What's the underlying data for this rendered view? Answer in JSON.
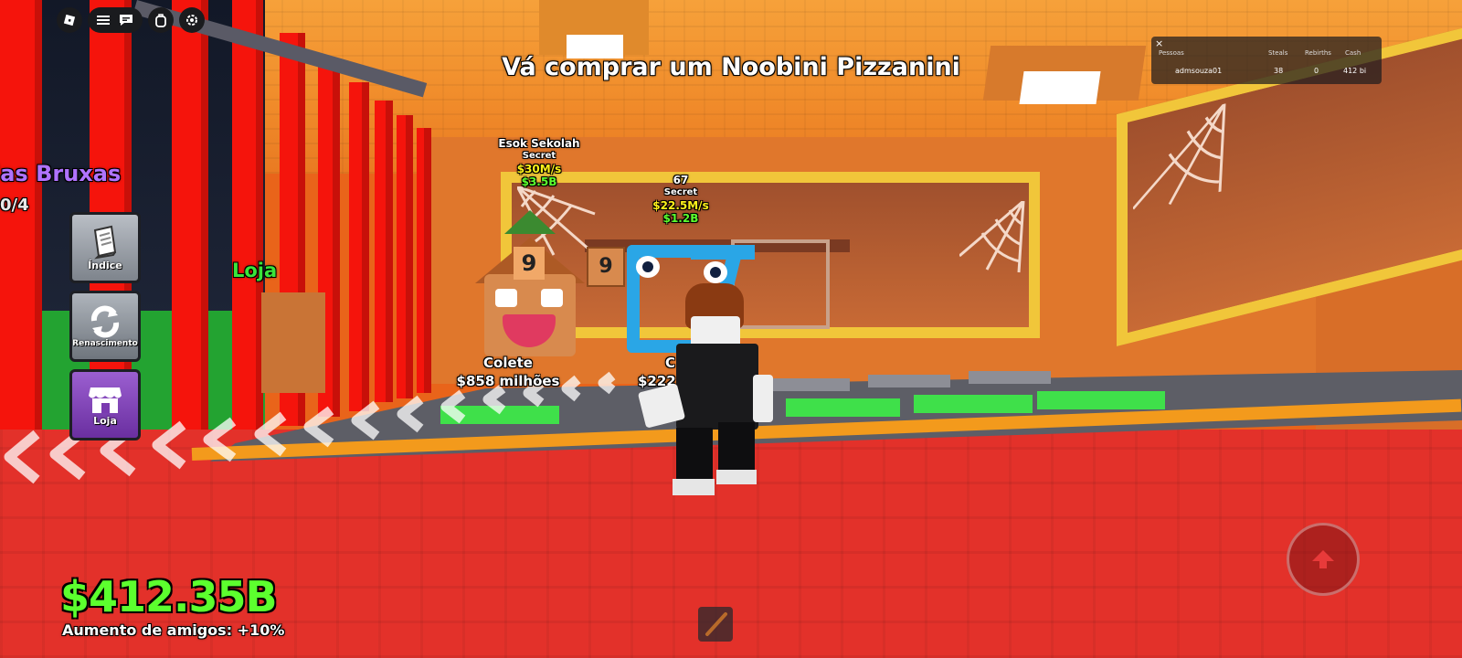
{
  "hud": {
    "objective_text": "Vá comprar um Noobini Pizzanini",
    "money": "$412.35B",
    "friend_boost": "Aumento de amigos: +10%"
  },
  "topbar": {
    "icons": [
      "roblox-logo-icon",
      "menu-icon",
      "chat-icon",
      "backpack-icon",
      "settings-icon"
    ]
  },
  "sidebar": {
    "items": [
      {
        "label": "Índice",
        "icon": "book-icon"
      },
      {
        "label": "Renascimento",
        "icon": "refresh-icon"
      },
      {
        "label": "Loja",
        "icon": "shop-icon"
      }
    ]
  },
  "partial_labels": {
    "event_title": "las Bruxas",
    "event_count": "0/4",
    "shop_sign": "Loja"
  },
  "leaderboard": {
    "close": "×",
    "headers": [
      "Pessoas",
      "Steals",
      "Rebirths",
      "Cash"
    ],
    "rows": [
      {
        "name": "admsouza01",
        "steals": "38",
        "rebirths": "0",
        "cash": "412 bi"
      }
    ]
  },
  "brainrots": [
    {
      "name": "Esok Sekolah",
      "rarity": "Secret",
      "rate": "$30M/s",
      "price": "$3.5B"
    },
    {
      "name": "67",
      "rarity": "Secret",
      "rate": "$22.5M/s",
      "price": "$1.2B"
    }
  ],
  "collect": {
    "label": "Colete",
    "amount": "$858 milhões",
    "partial_amount": "$222",
    "partial_label": "C"
  },
  "colors": {
    "money_green": "#5cff2e",
    "bar_red": "#f5140c",
    "event_purple": "#b073ff",
    "shop_green": "#39e53a",
    "rate_yellow": "#fff21a",
    "price_green": "#5cff2e"
  }
}
